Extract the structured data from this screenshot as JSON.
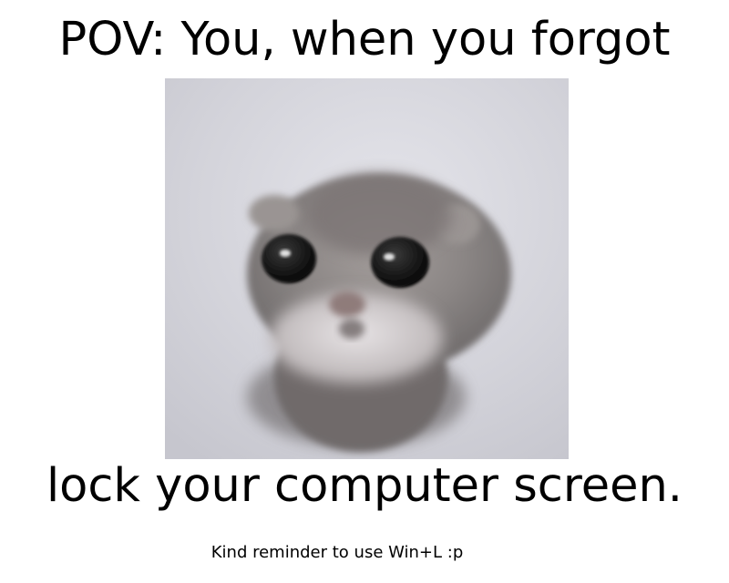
{
  "meme": {
    "top_text": "POV: You, when you forgot",
    "bottom_text": "lock your computer screen.",
    "reminder_text": "Kind reminder to use Win+L :p"
  },
  "image": {
    "subject": "hamster-photo",
    "background_color": "#d3d3da",
    "fur_color": "#8a8584"
  }
}
